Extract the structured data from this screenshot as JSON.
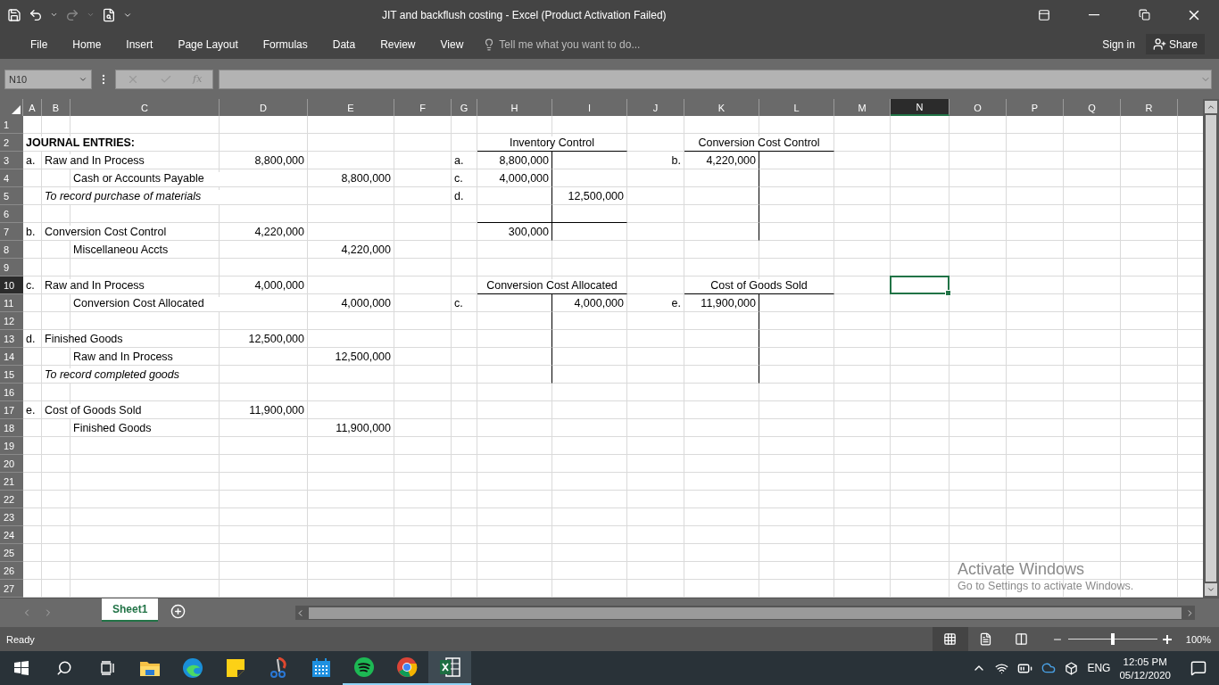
{
  "window": {
    "title": "JIT and backflush costing - Excel (Product Activation Failed)"
  },
  "ribbon_tabs": [
    "File",
    "Home",
    "Insert",
    "Page Layout",
    "Formulas",
    "Data",
    "Review",
    "View"
  ],
  "tell_me": {
    "placeholder": "Tell me what you want to do..."
  },
  "account": {
    "sign_in": "Sign in",
    "share": "Share"
  },
  "formula_bar": {
    "name_box": "N10",
    "fx": "fx"
  },
  "columns": [
    {
      "label": "A",
      "selected": false
    },
    {
      "label": "B",
      "selected": false
    },
    {
      "label": "C",
      "selected": false
    },
    {
      "label": "D",
      "selected": false
    },
    {
      "label": "E",
      "selected": false
    },
    {
      "label": "F",
      "selected": false
    },
    {
      "label": "G",
      "selected": false
    },
    {
      "label": "H",
      "selected": false
    },
    {
      "label": "I",
      "selected": false
    },
    {
      "label": "J",
      "selected": false
    },
    {
      "label": "K",
      "selected": false
    },
    {
      "label": "L",
      "selected": false
    },
    {
      "label": "M",
      "selected": false
    },
    {
      "label": "N",
      "selected": true
    },
    {
      "label": "O",
      "selected": false
    },
    {
      "label": "P",
      "selected": false
    },
    {
      "label": "Q",
      "selected": false
    },
    {
      "label": "R",
      "selected": false
    }
  ],
  "rows": [
    {
      "number": "1",
      "selected": false
    },
    {
      "number": "2",
      "selected": false,
      "cells": {
        "A": {
          "kind": "heading",
          "text": "JOURNAL ENTRIES:"
        },
        "H": {
          "kind": "account-title",
          "text": "Inventory Control"
        },
        "K": {
          "kind": "account-title",
          "text": "Conversion Cost Control"
        }
      }
    },
    {
      "number": "3",
      "selected": false,
      "cells": {
        "A": {
          "kind": "label",
          "text": "a."
        },
        "B": {
          "kind": "label",
          "text": "Raw and In Process"
        },
        "D": {
          "kind": "amount",
          "text": "8,800,000"
        },
        "G": {
          "kind": "label",
          "text": "a."
        },
        "H": {
          "kind": "amount",
          "text": "8,800,000",
          "line_right": true
        },
        "J": {
          "kind": "ref-right",
          "text": "b."
        },
        "K": {
          "kind": "amount",
          "text": "4,220,000",
          "line_right": true
        }
      }
    },
    {
      "number": "4",
      "selected": false,
      "cells": {
        "C": {
          "kind": "label",
          "text": "Cash or Accounts Payable"
        },
        "E": {
          "kind": "amount",
          "text": "8,800,000"
        },
        "G": {
          "kind": "label",
          "text": "c."
        },
        "H": {
          "kind": "amount",
          "text": "4,000,000",
          "line_right": true
        },
        "K": {
          "line_right": true
        }
      }
    },
    {
      "number": "5",
      "selected": false,
      "cells": {
        "B": {
          "kind": "memo",
          "text": "To record purchase of materials"
        },
        "G": {
          "kind": "label",
          "text": "d."
        },
        "H": {
          "line_right": true
        },
        "I": {
          "kind": "amount",
          "text": "12,500,000"
        },
        "K": {
          "line_right": true
        }
      }
    },
    {
      "number": "6",
      "selected": false,
      "cells": {
        "H": {
          "line_right": true,
          "line_below": true
        },
        "I": {
          "line_below": true
        },
        "K": {
          "line_right": true
        }
      }
    },
    {
      "number": "7",
      "selected": false,
      "cells": {
        "A": {
          "kind": "label",
          "text": "b."
        },
        "B": {
          "kind": "label",
          "text": "Conversion Cost Control"
        },
        "D": {
          "kind": "amount",
          "text": "4,220,000"
        },
        "H": {
          "kind": "amount",
          "text": "300,000",
          "line_right": true
        },
        "K": {
          "line_right": true
        }
      }
    },
    {
      "number": "8",
      "selected": false,
      "cells": {
        "C": {
          "kind": "label",
          "text": "Miscellaneou Accts"
        },
        "E": {
          "kind": "amount",
          "text": "4,220,000"
        }
      }
    },
    {
      "number": "9",
      "selected": false
    },
    {
      "number": "10",
      "selected": true,
      "cells": {
        "A": {
          "kind": "label",
          "text": "c."
        },
        "B": {
          "kind": "label",
          "text": "Raw and In Process"
        },
        "D": {
          "kind": "amount",
          "text": "4,000,000"
        },
        "H": {
          "kind": "account-title",
          "text": "Conversion Cost Allocated"
        },
        "K": {
          "kind": "account-title",
          "text": "Cost of Goods Sold"
        }
      }
    },
    {
      "number": "11",
      "selected": false,
      "cells": {
        "C": {
          "kind": "label",
          "text": "Conversion Cost Allocated"
        },
        "E": {
          "kind": "amount",
          "text": "4,000,000"
        },
        "G": {
          "kind": "label",
          "text": "c."
        },
        "H": {
          "line_right": true
        },
        "I": {
          "kind": "amount",
          "text": "4,000,000"
        },
        "J": {
          "kind": "ref-right",
          "text": "e."
        },
        "K": {
          "kind": "amount",
          "text": "11,900,000",
          "line_right": true
        }
      }
    },
    {
      "number": "12",
      "selected": false,
      "cells": {
        "H": {
          "line_right": true
        },
        "K": {
          "line_right": true
        }
      }
    },
    {
      "number": "13",
      "selected": false,
      "cells": {
        "A": {
          "kind": "label",
          "text": "d."
        },
        "B": {
          "kind": "label",
          "text": "Finished Goods"
        },
        "D": {
          "kind": "amount",
          "text": "12,500,000"
        },
        "H": {
          "line_right": true
        },
        "K": {
          "line_right": true
        }
      }
    },
    {
      "number": "14",
      "selected": false,
      "cells": {
        "C": {
          "kind": "label",
          "text": "Raw and In Process"
        },
        "E": {
          "kind": "amount",
          "text": "12,500,000"
        },
        "H": {
          "line_right": true
        },
        "K": {
          "line_right": true
        }
      }
    },
    {
      "number": "15",
      "selected": false,
      "cells": {
        "B": {
          "kind": "memo",
          "text": "To record completed goods"
        },
        "H": {
          "line_right": true
        },
        "K": {
          "line_right": true
        }
      }
    },
    {
      "number": "16",
      "selected": false
    },
    {
      "number": "17",
      "selected": false,
      "cells": {
        "A": {
          "kind": "label",
          "text": "e."
        },
        "B": {
          "kind": "label",
          "text": "Cost of Goods Sold"
        },
        "D": {
          "kind": "amount",
          "text": "11,900,000"
        }
      }
    },
    {
      "number": "18",
      "selected": false,
      "cells": {
        "C": {
          "kind": "label",
          "text": "Finished Goods"
        },
        "E": {
          "kind": "amount",
          "text": "11,900,000"
        }
      }
    },
    {
      "number": "19",
      "selected": false
    },
    {
      "number": "20",
      "selected": false
    },
    {
      "number": "21",
      "selected": false
    },
    {
      "number": "22",
      "selected": false
    },
    {
      "number": "23",
      "selected": false
    },
    {
      "number": "24",
      "selected": false
    },
    {
      "number": "25",
      "selected": false
    },
    {
      "number": "26",
      "selected": false
    },
    {
      "number": "27",
      "selected": false
    }
  ],
  "sheet_tabs": [
    {
      "label": "Sheet1",
      "selected": true
    }
  ],
  "status_bar": {
    "text": "Ready",
    "views": [
      {
        "kind": "normal",
        "selected": true
      },
      {
        "kind": "page-layout",
        "selected": false
      },
      {
        "kind": "page-break",
        "selected": false
      }
    ],
    "zoom": {
      "level": 0.5,
      "reading": "100%"
    }
  },
  "taskbar": {
    "apps": [
      {
        "kind": "explorer",
        "running": false,
        "selected": false
      },
      {
        "kind": "edge",
        "running": false,
        "selected": false
      },
      {
        "kind": "notes",
        "running": false,
        "selected": false
      },
      {
        "kind": "snip",
        "running": false,
        "selected": false
      },
      {
        "kind": "calendar",
        "running": false,
        "selected": false
      },
      {
        "kind": "music",
        "running": true,
        "selected": false
      },
      {
        "kind": "browser",
        "running": true,
        "selected": false
      },
      {
        "kind": "sheets",
        "running": true,
        "selected": true
      }
    ],
    "language": "ENG",
    "time": "12:05 PM",
    "date": "05/12/2020"
  },
  "watermark": {
    "title": "Activate Windows",
    "subtitle": "Go to Settings to activate Windows."
  }
}
